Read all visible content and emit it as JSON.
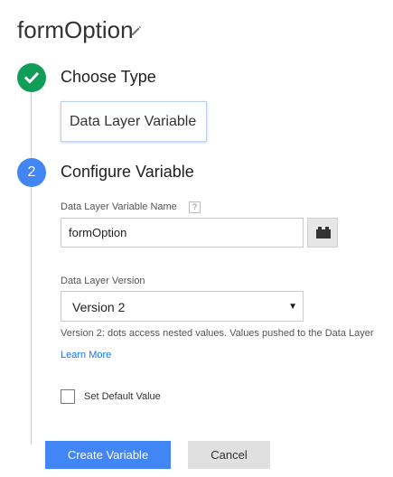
{
  "header": {
    "title": "formOption",
    "edit_icon": "pencil-icon"
  },
  "step1": {
    "status_icon": "check-icon",
    "title": "Choose Type",
    "type_label": "Data Layer Variable"
  },
  "step2": {
    "number": "2",
    "title": "Configure Variable",
    "name_label": "Data Layer Variable Name",
    "help_mark": "?",
    "name_value": "formOption",
    "variable_button_icon": "variable-picker-icon",
    "version_label": "Data Layer Version",
    "version_selected": "Version 2",
    "version_help": "Version 2: dots access nested values. Values pushed to the Data Layer",
    "learn_more": "Learn More",
    "default_value_label": "Set Default Value"
  },
  "actions": {
    "create_label": "Create Variable",
    "cancel_label": "Cancel"
  },
  "colors": {
    "success": "#0f9d58",
    "accent": "#4285f4",
    "link": "#1a73e8"
  }
}
